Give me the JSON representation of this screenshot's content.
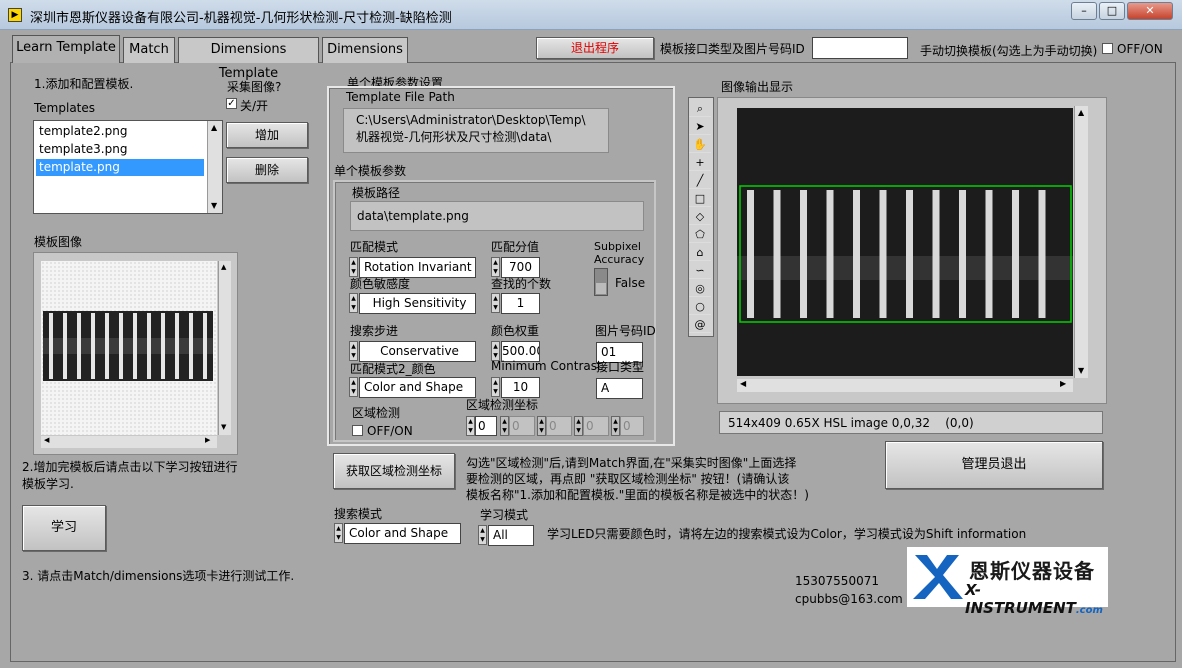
{
  "window": {
    "title": "深圳市恩斯仪器设备有限公司-机器视觉-几何形状检测-尺寸检测-缺陷检测",
    "min": "–",
    "max": "□",
    "close": "✕"
  },
  "tabs": [
    "Learn Template",
    "Match",
    "Dimensions Template",
    "Dimensions"
  ],
  "toolbar": {
    "exit_label": "退出程序",
    "template_type_label": "模板接口类型及图片号码ID",
    "template_type_value": "",
    "manual_switch_label": "手动切换模板(勾选上为手动切换)",
    "manual_switch_toggle": "OFF/ON"
  },
  "left": {
    "step1": "1.添加和配置模板.",
    "templates_label": "Templates",
    "templates": [
      "template2.png",
      "template3.png",
      "template.png"
    ],
    "capture_label": "采集图像?",
    "capture_check": "关/开",
    "add_label": "增加",
    "delete_label": "删除",
    "template_image_label": "模板图像",
    "step2": "2.增加完模板后请点击以下学习按钮进行模板学习.",
    "learn_label": "学习",
    "step3": "3. 请点击Match/dimensions选项卡进行测试工作."
  },
  "settings": {
    "group_label": "单个模板参数设置",
    "file_path_label": "Template File Path",
    "file_path_lines": [
      "C:\\Users\\Administrator\\Desktop\\Temp\\",
      "机器视觉-几何形状及尺寸检测\\data\\"
    ],
    "params_label": "单个模板参数",
    "path_label": "模板路径",
    "path_value": "data\\template.png",
    "match_mode_label": "匹配模式",
    "match_mode_value": "Rotation Invariant",
    "match_score_label": "匹配分值",
    "match_score_value": "700",
    "subpixel_label": "Subpixel Accuracy",
    "subpixel_value": "False",
    "color_sens_label": "颜色敏感度",
    "color_sens_value": "High Sensitivity",
    "find_count_label": "查找的个数",
    "find_count_value": "1",
    "search_step_label": "搜索步进",
    "search_step_value": "Conservative",
    "color_weight_label": "颜色权重",
    "color_weight_value": "500.00",
    "image_id_label": "图片号码ID",
    "image_id_value": "01",
    "match_mode2_label": "匹配模式2_颜色",
    "match_mode2_value": "Color and Shape",
    "min_contrast_label": "Minimum Contrast",
    "min_contrast_value": "10",
    "interface_type_label": "接口类型",
    "interface_type_value": "A",
    "region_detect_label": "区域检测",
    "region_detect_toggle": "OFF/ON",
    "region_coords_label": "区域检测坐标",
    "region_coords": [
      "0",
      "0",
      "0",
      "0",
      "0"
    ]
  },
  "region_btn_label": "获取区域检测坐标",
  "region_instructions": [
    "勾选\"区域检测\"后,请到Match界面,在\"采集实时图像\"上面选择",
    "要检测的区域，再点即  \"获取区域检测坐标\" 按钮！(请确认该",
    "模板名称\"1.添加和配置模板.\"里面的模板名称是被选中的状态！)"
  ],
  "search_mode_label": "搜索模式",
  "search_mode_value": "Color and Shape",
  "learn_mode_label": "学习模式",
  "learn_mode_value": "All",
  "learn_note": "学习LED只需要颜色时，请将左边的搜索模式设为Color，学习模式设为Shift information",
  "image_output_label": "图像输出显示",
  "image_status": "514x409 0.65X HSL image 0,0,32    (0,0)",
  "admin_exit_label": "管理员退出",
  "contact": {
    "phone": "15307550071",
    "email": "cpubbs@163.com"
  },
  "logo": {
    "cn": "恩斯仪器设备",
    "en": "X-INSTRUMENT",
    "suffix": ".com"
  },
  "tools": [
    "zoom-icon",
    "pointer-icon",
    "pan-icon",
    "crosshair-icon",
    "line-icon",
    "rectangle-icon",
    "rotated-rect-icon",
    "polygon-icon",
    "broken-line-icon",
    "freehand-icon",
    "annulus-icon",
    "oval-icon",
    "spiral-icon"
  ]
}
